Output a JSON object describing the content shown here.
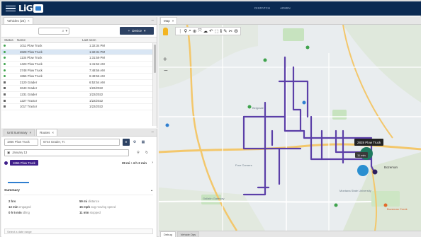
{
  "app": {
    "logo": "LiG",
    "top_menu": [
      "DISPATCH",
      "ADMIN"
    ]
  },
  "vehicles_panel": {
    "tab_label": "Vehicles (24)",
    "device_button": "Device",
    "columns": [
      "Status",
      "Name",
      "Last seen"
    ],
    "rows": [
      {
        "status": "online",
        "name": "1011 Plow Truck",
        "last": "1:32:34 PM"
      },
      {
        "status": "online",
        "name": "2828 Plow Truck",
        "last": "1:32:31 PM",
        "selected": true
      },
      {
        "status": "online",
        "name": "1134 Plow Truck",
        "last": "1:31:59 PM"
      },
      {
        "status": "online",
        "name": "1423 Plow Truck",
        "last": "1:41:52 AM"
      },
      {
        "status": "online",
        "name": "3748 Plow Truck",
        "last": "7:48:56 AM"
      },
      {
        "status": "online",
        "name": "1866 Plow Truck",
        "last": "6:48:56 AM"
      },
      {
        "status": "offline",
        "name": "2120 Grader",
        "last": "6:52:54 AM"
      },
      {
        "status": "offline",
        "name": "2643 Grader",
        "last": "1/22/2022"
      },
      {
        "status": "offline",
        "name": "1231 Grader",
        "last": "1/22/2022"
      },
      {
        "status": "offline",
        "name": "1227 Tractor",
        "last": "1/22/2022"
      },
      {
        "status": "offline",
        "name": "1017 Tractor",
        "last": "1/22/2022"
      }
    ]
  },
  "route_panel": {
    "tabs": [
      "Unit Summary",
      "Routes"
    ],
    "vehicle_select": "1866 Plow Truck",
    "second_select": "6744 Grader, Tr.",
    "date": "January 13",
    "active_truck": "1866 Plow Truck",
    "distance": "39 mi • 4 h 2 min",
    "summary_title": "Summary",
    "stats": [
      {
        "left_val": "2 hrs",
        "left_key": "",
        "right_val": "59 mi",
        "right_key": "distance"
      },
      {
        "left_val": "13 min",
        "left_key": "engaged",
        "right_val": "15 mph",
        "right_key": "avg moving speed"
      },
      {
        "left_val": "0 h 5 min",
        "left_key": "idling",
        "right_val": "11 min",
        "right_key": "stopped"
      }
    ],
    "footer": "Select a date range"
  },
  "map_panel": {
    "tab_label": "Map",
    "vehicle_label": "2828 Plow Truck",
    "time_label": "11 min",
    "places": [
      "Belgrade",
      "Four Corners",
      "Bozeman",
      "Gallatin Gateway",
      "Montana State University",
      "Bozeman Creek"
    ],
    "bottom_tabs": [
      "Debug",
      "Vehicle Ops"
    ]
  }
}
